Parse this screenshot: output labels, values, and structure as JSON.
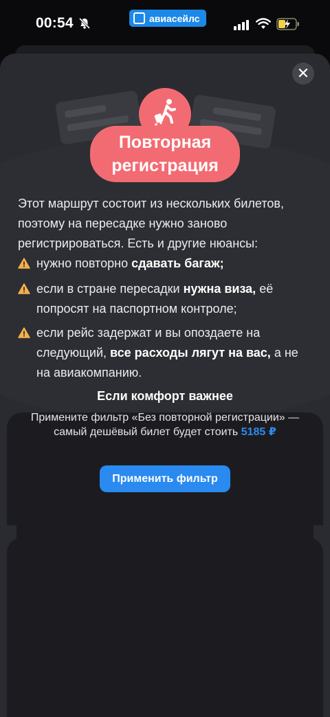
{
  "status": {
    "time": "00:54",
    "app_badge": "авиасейлс"
  },
  "modal": {
    "title_line1": "Повторная",
    "title_line2": "регистрация",
    "intro": "Этот маршрут состоит из нескольких билетов, поэтому на пересадке нужно заново регистрироваться. Есть и другие нюансы:",
    "bullets": [
      {
        "pre": "нужно повторно ",
        "bold": "сдавать багаж;",
        "post": ""
      },
      {
        "pre": "если в стране пересадки ",
        "bold": "нужна виза,",
        "post": " её попросят на паспортном контроле;"
      },
      {
        "pre": "если рейс задержат и вы опоздаете на следующий, ",
        "bold": "все расходы лягут на вас,",
        "post": " а не на авиакомпанию."
      }
    ]
  },
  "comfort": {
    "title": "Если комфорт важнее",
    "text_before_price": "Примените фильтр «Без повторной регистрации» — самый дешёвый билет будет стоить ",
    "price": "5185 ₽",
    "button": "Применить фильтр"
  },
  "colors": {
    "accent_red": "#f36b72",
    "accent_blue": "#2a8af0",
    "warning": "#f4b04a"
  },
  "icons": [
    "bell-off-icon",
    "signal-icon",
    "wifi-icon",
    "battery-charging-icon",
    "close-icon",
    "traveler-luggage-icon",
    "warning-icon"
  ]
}
